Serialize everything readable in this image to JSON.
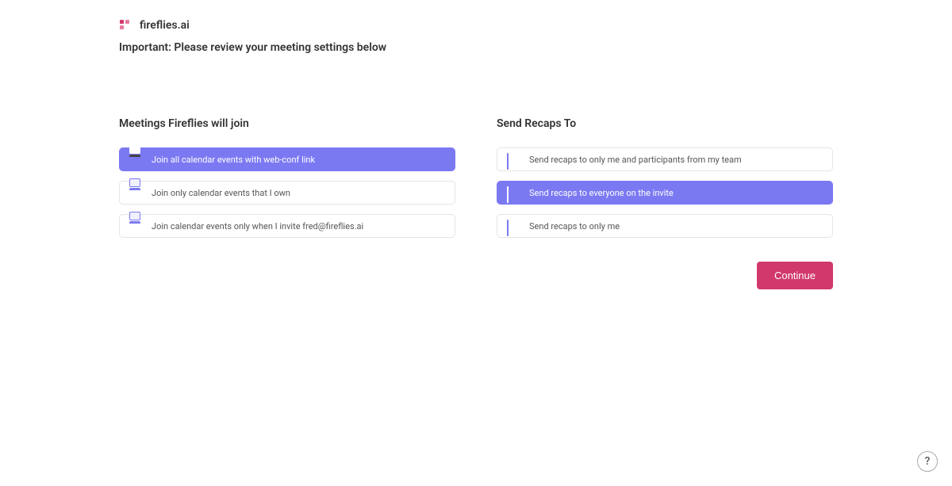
{
  "brand": "fireflies.ai",
  "important_message": "Important: Please review your meeting settings below",
  "meetings": {
    "title": "Meetings Fireflies will join",
    "options": [
      {
        "label": "Join all calendar events with web-conf link"
      },
      {
        "label": "Join only calendar events that I own"
      },
      {
        "label": "Join calendar events only when I invite fred@fireflies.ai"
      }
    ],
    "selected_index": 0
  },
  "recaps": {
    "title": "Send Recaps To",
    "options": [
      {
        "label": "Send recaps to only me and participants from my team"
      },
      {
        "label": "Send recaps to everyone on the invite"
      },
      {
        "label": "Send recaps to only me"
      }
    ],
    "selected_index": 1
  },
  "continue_label": "Continue",
  "help_label": "?"
}
